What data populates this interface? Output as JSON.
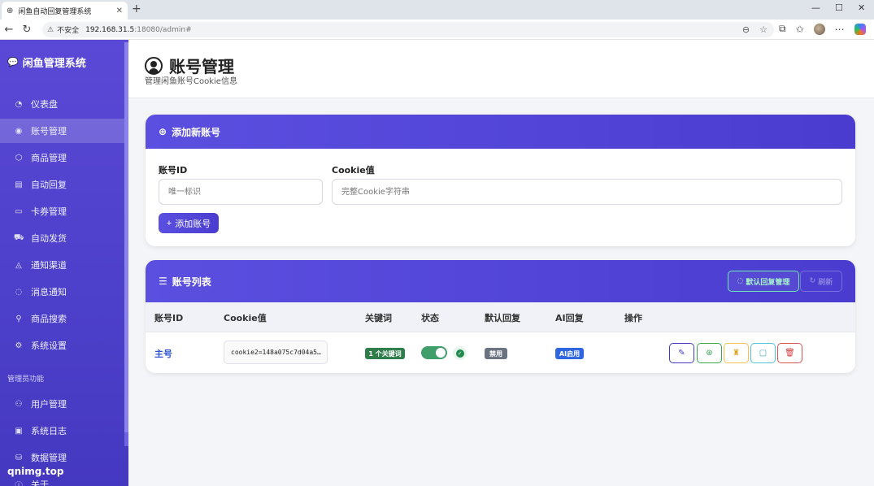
{
  "browser": {
    "tab_title": "闲鱼自动回复管理系统",
    "tab_close": "✕",
    "new_tab": "+",
    "insecure_label": "不安全",
    "url_host": "192.168.31.5",
    "url_path": ":18080/admin#",
    "window_controls": [
      "—",
      "☐",
      "✕"
    ]
  },
  "sidebar": {
    "brand": "闲鱼管理系统",
    "items": [
      {
        "label": "仪表盘",
        "icon": "dashboard-icon",
        "glyph": "◔"
      },
      {
        "label": "账号管理",
        "icon": "user-circle-icon",
        "glyph": "◉",
        "active": true
      },
      {
        "label": "商品管理",
        "icon": "box-icon",
        "glyph": "⬡"
      },
      {
        "label": "自动回复",
        "icon": "message-icon",
        "glyph": "▤"
      },
      {
        "label": "卡券管理",
        "icon": "card-icon",
        "glyph": "▭"
      },
      {
        "label": "自动发货",
        "icon": "truck-icon",
        "glyph": "⛟"
      },
      {
        "label": "通知渠道",
        "icon": "bell-icon",
        "glyph": "◬"
      },
      {
        "label": "消息通知",
        "icon": "chat-icon",
        "glyph": "◌"
      },
      {
        "label": "商品搜索",
        "icon": "search-icon",
        "glyph": "⚲"
      },
      {
        "label": "系统设置",
        "icon": "gear-icon",
        "glyph": "⚙"
      }
    ],
    "admin_section": "管理员功能",
    "admin_items": [
      {
        "label": "用户管理",
        "icon": "users-icon",
        "glyph": "⚇"
      },
      {
        "label": "系统日志",
        "icon": "file-icon",
        "glyph": "▣"
      },
      {
        "label": "数据管理",
        "icon": "database-icon",
        "glyph": "⛁"
      },
      {
        "label": "关于",
        "icon": "info-icon",
        "glyph": "ⓘ"
      }
    ],
    "watermark": "qnimg.top"
  },
  "header": {
    "title": "账号管理",
    "subtitle": "管理闲鱼账号Cookie信息"
  },
  "add_card": {
    "title": "添加新账号",
    "id_label": "账号ID",
    "id_placeholder": "唯一标识",
    "cookie_label": "Cookie值",
    "cookie_placeholder": "完整Cookie字符串",
    "add_button": "添加账号"
  },
  "list_card": {
    "title": "账号列表",
    "default_reply_button": "默认回复管理",
    "refresh_button": "刷新",
    "columns": [
      "账号ID",
      "Cookie值",
      "关键词",
      "状态",
      "默认回复",
      "AI回复",
      "操作"
    ],
    "rows": [
      {
        "id": "主号",
        "cookie": "cookie2=148a075c7d04a5…",
        "keywords": "1 个关键词",
        "enabled": true,
        "default_reply": "禁用",
        "ai_reply": "AI启用"
      }
    ]
  },
  "colors": {
    "accent": "#4f43d6",
    "success": "#2f7d4a",
    "link": "#2f55d4"
  }
}
